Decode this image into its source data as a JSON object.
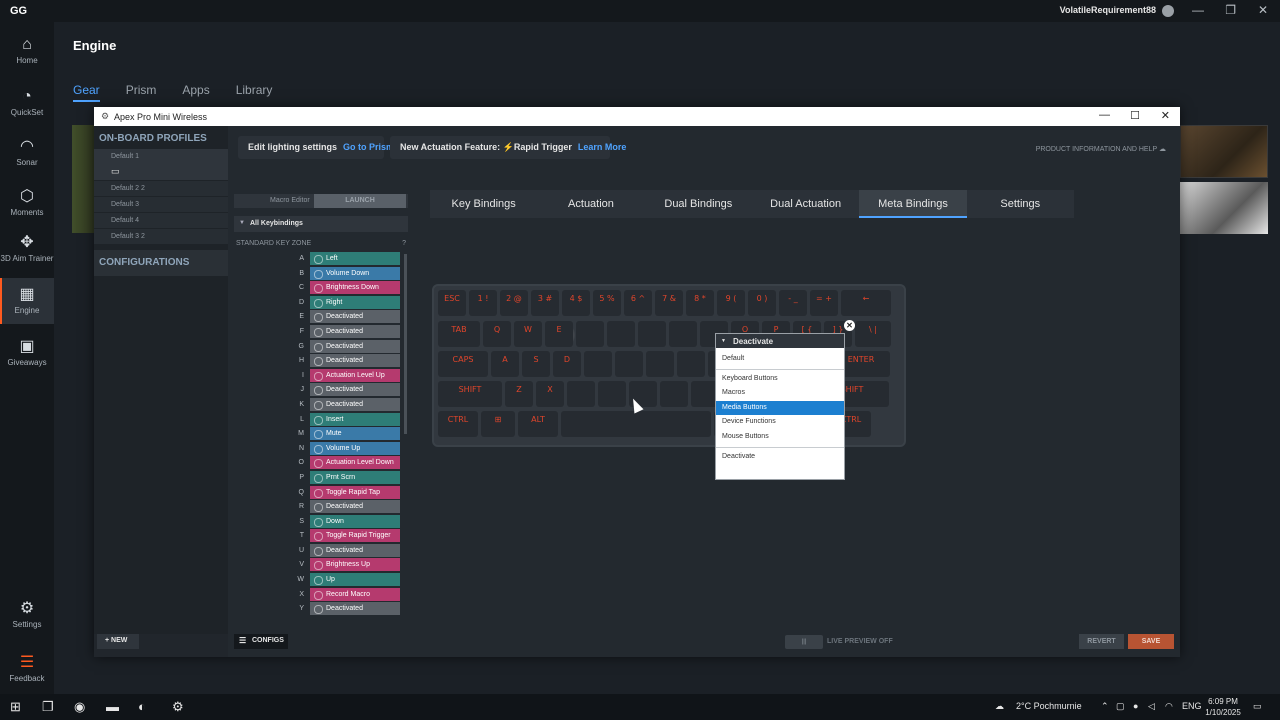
{
  "app": {
    "logo": "GG",
    "user": "VolatileRequirement88"
  },
  "nav": [
    {
      "label": "Home",
      "icon": "home-icon"
    },
    {
      "label": "QuickSet",
      "icon": "quickset-icon"
    },
    {
      "label": "Sonar",
      "icon": "sonar-icon"
    },
    {
      "label": "Moments",
      "icon": "moments-icon"
    },
    {
      "label": "3D Aim Trainer",
      "icon": "aim-trainer-icon"
    },
    {
      "label": "Engine",
      "icon": "engine-icon"
    },
    {
      "label": "Giveaways",
      "icon": "gift-icon"
    },
    {
      "label": "Settings",
      "icon": "gear-icon"
    },
    {
      "label": "Feedback",
      "icon": "feedback-icon"
    }
  ],
  "page": {
    "title": "Engine"
  },
  "top_tabs": [
    "Gear",
    "Prism",
    "Apps",
    "Library"
  ],
  "window": {
    "title": "Apex Pro Mini Wireless",
    "profiles_head": "ON-BOARD PROFILES",
    "profiles": [
      "Default 1",
      "Default 2 2",
      "Default 3",
      "Default 4",
      "Default 3 2"
    ],
    "configurations_head": "CONFIGURATIONS",
    "new_label": "NEW",
    "configs_label": "CONFIGS",
    "lighting": {
      "text": "Edit lighting settings",
      "link": "Go to Prism"
    },
    "actuation": {
      "text": "New Actuation Feature: ⚡Rapid Trigger",
      "link": "Learn More"
    },
    "product_info": "PRODUCT INFORMATION AND HELP",
    "macro_editor": "Macro Editor",
    "launch": "LAUNCH",
    "all_keybindings": "All Keybindings",
    "standard_key_zone": "STANDARD KEY ZONE",
    "help_mark": "?",
    "binding_tabs": [
      "Key Bindings",
      "Actuation",
      "Dual Bindings",
      "Dual Actuation",
      "Meta Bindings",
      "Settings"
    ],
    "active_binding_tab": "Meta Bindings",
    "keybindings": [
      {
        "key": "A",
        "value": "Left",
        "color": "teal"
      },
      {
        "key": "B",
        "value": "Volume Down",
        "color": "blue"
      },
      {
        "key": "C",
        "value": "Brightness Down",
        "color": "pink"
      },
      {
        "key": "D",
        "value": "Right",
        "color": "teal"
      },
      {
        "key": "E",
        "value": "Deactivated",
        "color": "grey"
      },
      {
        "key": "F",
        "value": "Deactivated",
        "color": "grey"
      },
      {
        "key": "G",
        "value": "Deactivated",
        "color": "grey"
      },
      {
        "key": "H",
        "value": "Deactivated",
        "color": "grey"
      },
      {
        "key": "I",
        "value": "Actuation Level Up",
        "color": "pink"
      },
      {
        "key": "J",
        "value": "Deactivated",
        "color": "grey"
      },
      {
        "key": "K",
        "value": "Deactivated",
        "color": "grey"
      },
      {
        "key": "L",
        "value": "Insert",
        "color": "teal"
      },
      {
        "key": "M",
        "value": "Mute",
        "color": "blue"
      },
      {
        "key": "N",
        "value": "Volume Up",
        "color": "blue"
      },
      {
        "key": "O",
        "value": "Actuation Level Down",
        "color": "pink"
      },
      {
        "key": "P",
        "value": "Prnt Scrn",
        "color": "teal"
      },
      {
        "key": "Q",
        "value": "Toggle Rapid Tap",
        "color": "pink"
      },
      {
        "key": "R",
        "value": "Deactivated",
        "color": "grey"
      },
      {
        "key": "S",
        "value": "Down",
        "color": "teal"
      },
      {
        "key": "T",
        "value": "Toggle Rapid Trigger",
        "color": "pink"
      },
      {
        "key": "U",
        "value": "Deactivated",
        "color": "grey"
      },
      {
        "key": "V",
        "value": "Brightness Up",
        "color": "pink"
      },
      {
        "key": "W",
        "value": "Up",
        "color": "teal"
      },
      {
        "key": "X",
        "value": "Record Macro",
        "color": "pink"
      },
      {
        "key": "Y",
        "value": "Deactivated",
        "color": "grey"
      }
    ],
    "keyboard_rows": [
      [
        "ESC",
        "1 !",
        "2 @",
        "3 #",
        "4 $",
        "5 %",
        "6 ^",
        "7 &",
        "8 *",
        "9 (",
        "0 )",
        "- _",
        "= +",
        "←"
      ],
      [
        "TAB",
        "Q",
        "W",
        "E",
        "",
        "",
        "",
        "",
        "",
        "O",
        "P",
        "[ {",
        "] }",
        "\\ |"
      ],
      [
        "CAPS",
        "A",
        "S",
        "D",
        "",
        "",
        "",
        "",
        "K",
        "L",
        "; :",
        "' \"",
        "ENTER"
      ],
      [
        "SHIFT",
        "Z",
        "X",
        "",
        "",
        "",
        "",
        "",
        ", <",
        ". >",
        "/ ?",
        "SHIFT"
      ],
      [
        "CTRL",
        "⊞",
        "ALT",
        "",
        "ALT",
        "⊞",
        "⚙",
        "CTRL"
      ]
    ],
    "dropdown": {
      "header": "Deactivate",
      "items": [
        "Default",
        "Keyboard Buttons",
        "Macros",
        "Media Buttons",
        "Device Functions",
        "Mouse Buttons",
        "Deactivate"
      ],
      "selected": "Media Buttons"
    },
    "live_preview": "LIVE PREVIEW OFF",
    "revert": "REVERT",
    "save": "SAVE"
  },
  "taskbar": {
    "weather": "2°C Pochmurnie",
    "lang": "ENG",
    "time": "6:09 PM",
    "date": "1/10/2025"
  },
  "colors": {
    "accent": "#4fa3ff",
    "brand": "#ff5a1f",
    "key_legend": "#e0452b",
    "save": "#b85433"
  }
}
